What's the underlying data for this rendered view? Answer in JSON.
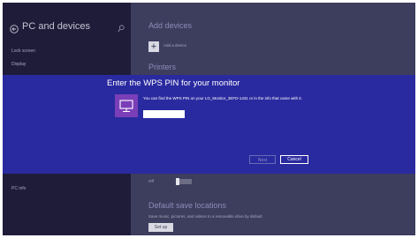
{
  "sidebar": {
    "title": "PC and devices",
    "items": [
      {
        "label": "Lock screen"
      },
      {
        "label": "Display"
      },
      {
        "label": "PC info"
      }
    ]
  },
  "main": {
    "add_devices_title": "Add devices",
    "add_device_label": "Add a device",
    "printers_title": "Printers",
    "toggle_state": "Off",
    "default_save_title": "Default save locations",
    "default_save_desc": "Save music, pictures, and videos to a removable drive by default",
    "setup_label": "Set up"
  },
  "dialog": {
    "title": "Enter the WPS PIN for your monitor",
    "message": "You can find the WPS PIN on your LG_Monitor_3EFD-1431 or in the info that came with it.",
    "pin_value": "",
    "next_label": "Next",
    "cancel_label": "Cancel"
  },
  "icons": {
    "back": "back-arrow-icon",
    "search": "search-icon",
    "add": "plus-icon",
    "monitor": "monitor-icon"
  },
  "colors": {
    "dialog_bg": "#2a2aa0",
    "monitor_tile": "#7a3fb8",
    "left_pane": "#1f1c3a",
    "right_pane": "#3d3d5e"
  }
}
